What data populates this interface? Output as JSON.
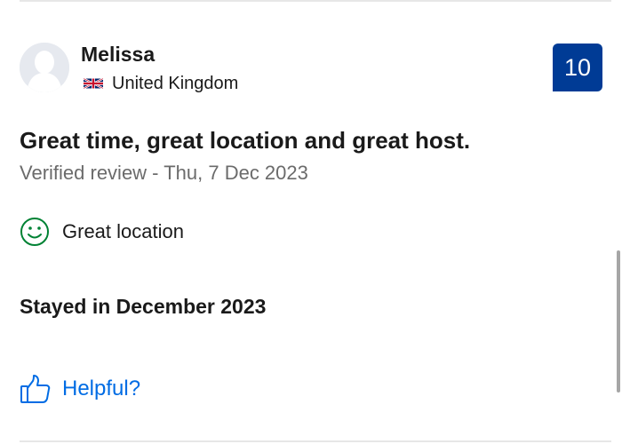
{
  "reviewer": {
    "name": "Melissa",
    "country": "United Kingdom",
    "flag_icon": "uk-flag-icon"
  },
  "score": "10",
  "review": {
    "title": "Great time, great location and great host.",
    "meta": "Verified review - Thu, 7 Dec 2023",
    "positive": "Great location",
    "stay": "Stayed in December 2023"
  },
  "actions": {
    "helpful_label": "Helpful?"
  },
  "colors": {
    "score_badge": "#003b95",
    "link": "#006ce4",
    "positive_icon": "#008234"
  }
}
